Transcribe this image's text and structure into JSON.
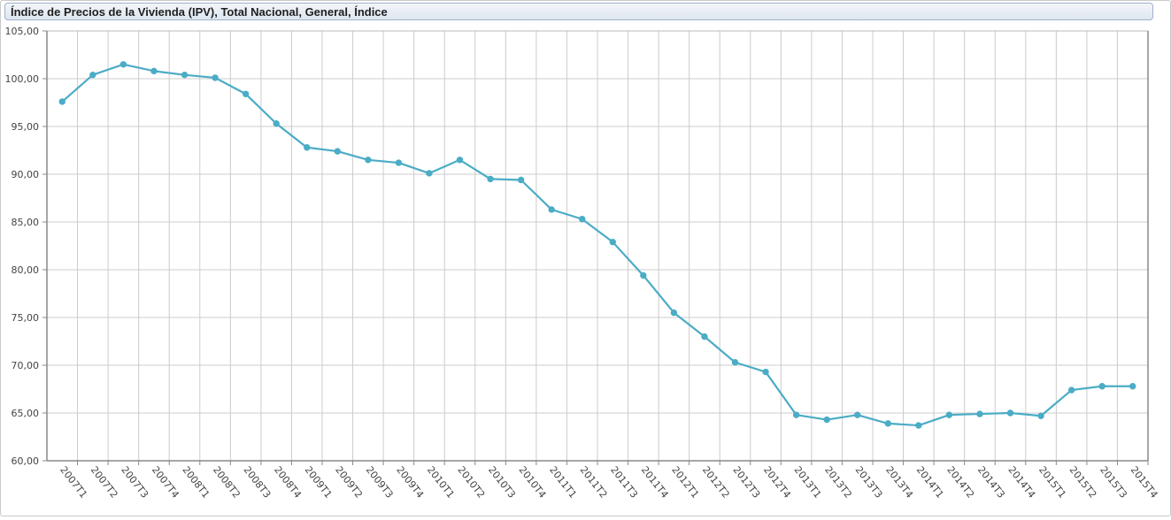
{
  "window": {
    "title": "Índice de Precios de la Vivienda (IPV), Total Nacional, General, Índice"
  },
  "chart_data": {
    "type": "line",
    "title": "Índice de Precios de la Vivienda (IPV), Total Nacional, General, Índice",
    "xlabel": "",
    "ylabel": "",
    "ylim": [
      60,
      105
    ],
    "grid": true,
    "colors": {
      "line": "#4bacc6",
      "grid": "#cccccc",
      "axis": "#888888",
      "tick_text": "#444444"
    },
    "y_ticks": [
      "60,00",
      "65,00",
      "70,00",
      "75,00",
      "80,00",
      "85,00",
      "90,00",
      "95,00",
      "100,00",
      "105,00"
    ],
    "y_tick_values": [
      60,
      65,
      70,
      75,
      80,
      85,
      90,
      95,
      100,
      105
    ],
    "categories": [
      "2007T1",
      "2007T2",
      "2007T3",
      "2007T4",
      "2008T1",
      "2008T2",
      "2008T3",
      "2008T4",
      "2009T1",
      "2009T2",
      "2009T3",
      "2009T4",
      "2010T1",
      "2010T2",
      "2010T3",
      "2010T4",
      "2011T1",
      "2011T2",
      "2011T3",
      "2011T4",
      "2012T1",
      "2012T2",
      "2012T3",
      "2012T4",
      "2013T1",
      "2013T2",
      "2013T3",
      "2013T4",
      "2014T1",
      "2014T2",
      "2014T3",
      "2014T4",
      "2015T1",
      "2015T2",
      "2015T3",
      "2015T4"
    ],
    "series": [
      {
        "values": [
          97.6,
          100.4,
          101.5,
          100.8,
          100.4,
          100.1,
          98.4,
          95.3,
          92.8,
          92.4,
          91.5,
          91.2,
          90.1,
          91.5,
          89.5,
          89.4,
          86.3,
          85.3,
          82.9,
          79.4,
          75.5,
          73.0,
          70.3,
          69.3,
          64.8,
          64.3,
          64.8,
          63.9,
          63.7,
          64.8,
          64.9,
          65.0,
          64.7,
          67.4,
          67.8,
          67.8
        ]
      }
    ]
  }
}
